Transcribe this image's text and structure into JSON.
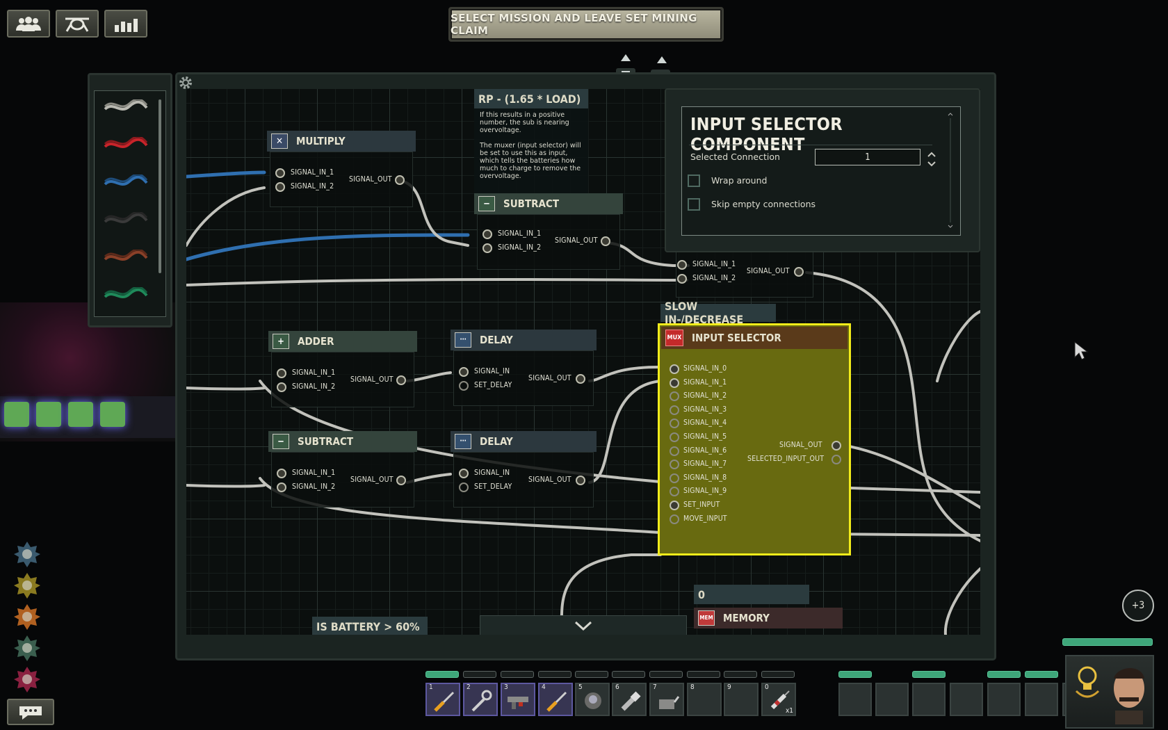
{
  "mission_button": "SELECT MISSION AND LEAVE SET MINING CLAIM",
  "top_buttons": [
    "crew-icon",
    "mission-icon",
    "status-icon"
  ],
  "wire_colors": [
    "#b8b8b0",
    "#c8242a",
    "#2f6fb0",
    "#3a3a3a",
    "#8a4028",
    "#1f8a5a"
  ],
  "labels": {
    "rp_load": {
      "title": "RP - (1.65 * LOAD)",
      "text1": "If this results in a positive number, the sub is nearing overvoltage.",
      "text2": "The muxer (input selector) will be set to use this as input, which tells the batteries how much to charge to remove the overvoltage."
    },
    "slow": "SLOW IN-/DECREASE",
    "battery": "IS BATTERY > 60%",
    "zero": "0"
  },
  "components": {
    "multiply": {
      "title": "MULTIPLY",
      "in1": "SIGNAL_IN_1",
      "in2": "SIGNAL_IN_2",
      "out": "SIGNAL_OUT"
    },
    "subtract_top": {
      "title": "SUBTRACT",
      "in1": "SIGNAL_IN_1",
      "in2": "SIGNAL_IN_2",
      "out": "SIGNAL_OUT"
    },
    "divide_hidden": {
      "in1": "SIGNAL_IN_1",
      "in2": "SIGNAL_IN_2",
      "out": "SIGNAL_OUT"
    },
    "adder": {
      "title": "ADDER",
      "in1": "SIGNAL_IN_1",
      "in2": "SIGNAL_IN_2",
      "out": "SIGNAL_OUT"
    },
    "delay1": {
      "title": "DELAY",
      "in": "SIGNAL_IN",
      "set": "SET_DELAY",
      "out": "SIGNAL_OUT"
    },
    "subtract_bottom": {
      "title": "SUBTRACT",
      "in1": "SIGNAL_IN_1",
      "in2": "SIGNAL_IN_2",
      "out": "SIGNAL_OUT"
    },
    "delay2": {
      "title": "DELAY",
      "in": "SIGNAL_IN",
      "set": "SET_DELAY",
      "out": "SIGNAL_OUT"
    },
    "input_selector": {
      "title": "INPUT SELECTOR",
      "badge": "MUX",
      "inputs": [
        "SIGNAL_IN_0",
        "SIGNAL_IN_1",
        "SIGNAL_IN_2",
        "SIGNAL_IN_3",
        "SIGNAL_IN_4",
        "SIGNAL_IN_5",
        "SIGNAL_IN_6",
        "SIGNAL_IN_7",
        "SIGNAL_IN_8",
        "SIGNAL_IN_9",
        "SET_INPUT",
        "MOVE_INPUT"
      ],
      "out": "SIGNAL_OUT",
      "selected_out": "SELECTED_INPUT_OUT"
    },
    "memory": {
      "title": "MEMORY"
    }
  },
  "inspector": {
    "title": "INPUT SELECTOR COMPONENT",
    "selected_connection_label": "Selected Connection",
    "selected_connection_value": "1",
    "wrap_around": "Wrap around",
    "skip_empty": "Skip empty connections"
  },
  "hotbar": {
    "slots": [
      {
        "num": "1",
        "item": "screwdriver-icon"
      },
      {
        "num": "2",
        "item": "wrench-icon"
      },
      {
        "num": "3",
        "item": "gun-icon"
      },
      {
        "num": "4",
        "item": "screwdriver-icon"
      },
      {
        "num": "5",
        "item": "diving-mask-icon"
      },
      {
        "num": "6",
        "item": "flashlight-icon"
      },
      {
        "num": "7",
        "item": "welder-icon"
      },
      {
        "num": "8",
        "item": ""
      },
      {
        "num": "9",
        "item": ""
      },
      {
        "num": "0",
        "item": "syringe-icon",
        "count": "x1"
      }
    ]
  },
  "notification_count": "+3",
  "side_icons": [
    "skill-icon-1",
    "skill-icon-2",
    "skill-icon-3",
    "skill-icon-4",
    "skill-icon-5"
  ]
}
